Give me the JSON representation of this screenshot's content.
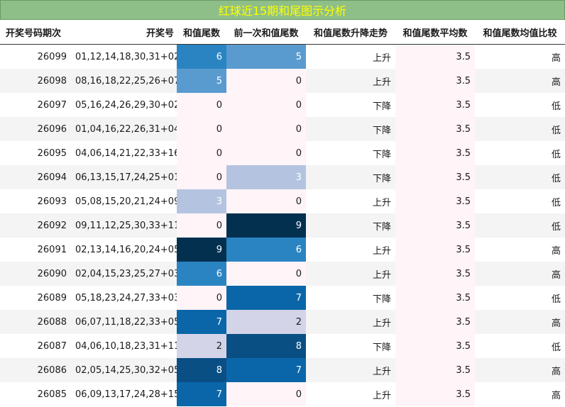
{
  "title": "红球近15期和尾图示分析",
  "chart_data": {
    "type": "table",
    "columns": [
      "开奖号码期次",
      "开奖号",
      "和值尾数",
      "前一次和值尾数",
      "和值尾数升降走势",
      "和值尾数平均数",
      "和值尾数均值比较"
    ],
    "rows": [
      {
        "period": "26099",
        "numbers": "01,12,14,18,30,31+02",
        "tail": 6,
        "prev_tail": 5,
        "trend": "上升",
        "avg": "3.5",
        "compare": "高"
      },
      {
        "period": "26098",
        "numbers": "08,16,18,22,25,26+07",
        "tail": 5,
        "prev_tail": 0,
        "trend": "上升",
        "avg": "3.5",
        "compare": "高"
      },
      {
        "period": "26097",
        "numbers": "05,16,24,26,29,30+02",
        "tail": 0,
        "prev_tail": 0,
        "trend": "下降",
        "avg": "3.5",
        "compare": "低"
      },
      {
        "period": "26096",
        "numbers": "01,04,16,22,26,31+04",
        "tail": 0,
        "prev_tail": 0,
        "trend": "下降",
        "avg": "3.5",
        "compare": "低"
      },
      {
        "period": "26095",
        "numbers": "04,06,14,21,22,33+16",
        "tail": 0,
        "prev_tail": 0,
        "trend": "下降",
        "avg": "3.5",
        "compare": "低"
      },
      {
        "period": "26094",
        "numbers": "06,13,15,17,24,25+01",
        "tail": 0,
        "prev_tail": 3,
        "trend": "下降",
        "avg": "3.5",
        "compare": "低"
      },
      {
        "period": "26093",
        "numbers": "05,08,15,20,21,24+09",
        "tail": 3,
        "prev_tail": 0,
        "trend": "上升",
        "avg": "3.5",
        "compare": "低"
      },
      {
        "period": "26092",
        "numbers": "09,11,12,25,30,33+11",
        "tail": 0,
        "prev_tail": 9,
        "trend": "下降",
        "avg": "3.5",
        "compare": "低"
      },
      {
        "period": "26091",
        "numbers": "02,13,14,16,20,24+05",
        "tail": 9,
        "prev_tail": 6,
        "trend": "上升",
        "avg": "3.5",
        "compare": "高"
      },
      {
        "period": "26090",
        "numbers": "02,04,15,23,25,27+03",
        "tail": 6,
        "prev_tail": 0,
        "trend": "上升",
        "avg": "3.5",
        "compare": "高"
      },
      {
        "period": "26089",
        "numbers": "05,18,23,24,27,33+03",
        "tail": 0,
        "prev_tail": 7,
        "trend": "下降",
        "avg": "3.5",
        "compare": "低"
      },
      {
        "period": "26088",
        "numbers": "06,07,11,18,22,33+05",
        "tail": 7,
        "prev_tail": 2,
        "trend": "上升",
        "avg": "3.5",
        "compare": "高"
      },
      {
        "period": "26087",
        "numbers": "04,06,10,18,23,31+11",
        "tail": 2,
        "prev_tail": 8,
        "trend": "下降",
        "avg": "3.5",
        "compare": "低"
      },
      {
        "period": "26086",
        "numbers": "02,05,14,25,30,32+05",
        "tail": 8,
        "prev_tail": 7,
        "trend": "上升",
        "avg": "3.5",
        "compare": "高"
      },
      {
        "period": "26085",
        "numbers": "06,09,13,17,24,28+15",
        "tail": 7,
        "prev_tail": 0,
        "trend": "上升",
        "avg": "3.5",
        "compare": "高"
      }
    ]
  },
  "colors": {
    "title_bg": "#8fbf88",
    "title_text": "#ffff00",
    "heat_scale": {
      "0": "#fff4f8",
      "1": "#e8e4f0",
      "2": "#d4d4e8",
      "3": "#b4c4e0",
      "4": "#8cb0d8",
      "5": "#5a9bcf",
      "6": "#2b84c2",
      "7": "#0a66a8",
      "8": "#0a4f84",
      "9": "#043050"
    }
  }
}
